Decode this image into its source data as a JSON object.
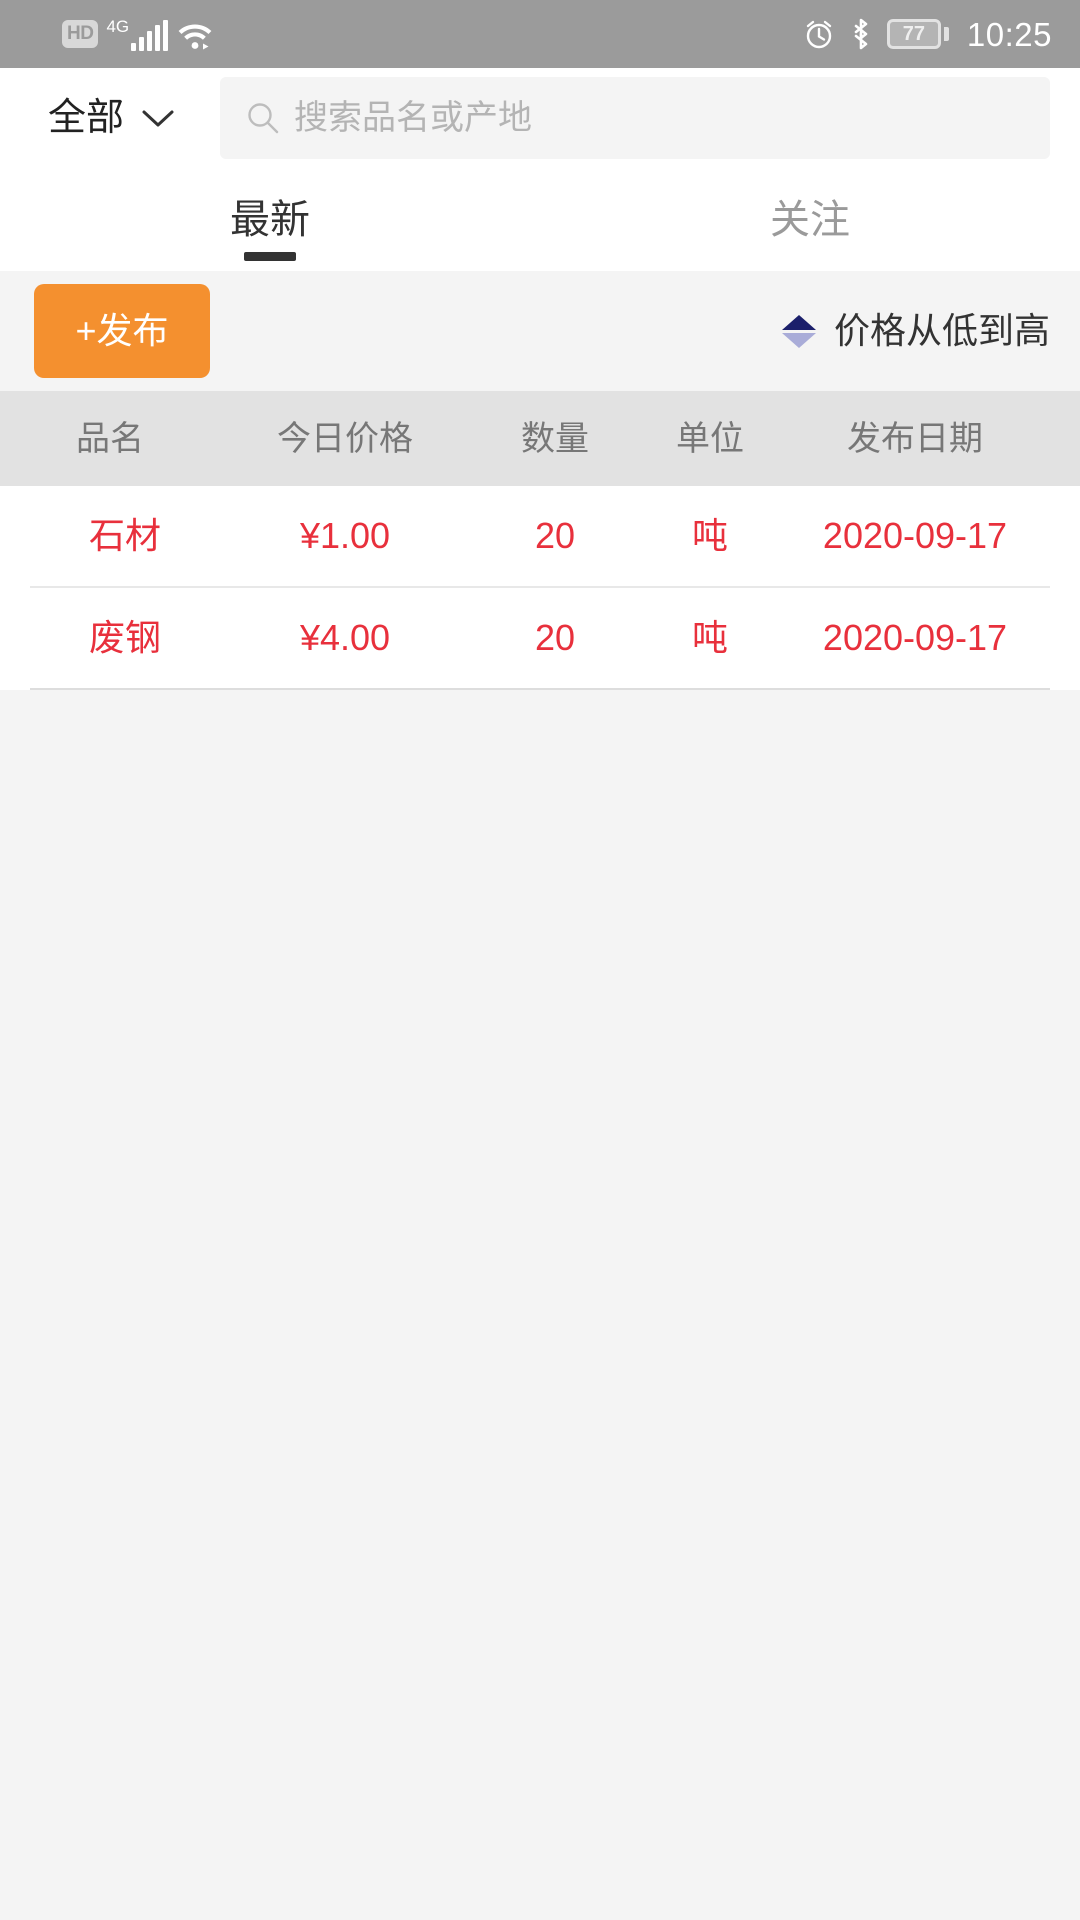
{
  "status_bar": {
    "hd_label": "HD",
    "network_label": "4G",
    "signal_icon": "signal-bars-icon",
    "wifi_icon": "wifi-icon",
    "alarm_icon": "alarm-clock-icon",
    "bluetooth_icon": "bluetooth-icon",
    "battery_level": "77",
    "time": "10:25",
    "background_color": "#9b9b9b"
  },
  "search_header": {
    "category_label": "全部",
    "category_chevron_icon": "chevron-down-icon",
    "search_icon": "search-icon",
    "search_placeholder": "搜索品名或产地",
    "search_value": ""
  },
  "tabs": [
    {
      "label": "最新",
      "active": true
    },
    {
      "label": "关注",
      "active": false
    }
  ],
  "action_bar": {
    "publish_label": "+发布",
    "publish_color": "#f4902f",
    "sort_label": "价格从低到高",
    "sort_icon": "sort-ascending-icon",
    "sort_up_color": "#1b1f6b",
    "sort_down_color": "#a9acd8"
  },
  "table": {
    "headers": [
      "品名",
      "今日价格",
      "数量",
      "单位",
      "发布日期"
    ],
    "row_text_color": "#e8303c",
    "rows": [
      {
        "name": "石材",
        "price": "¥1.00",
        "quantity": "20",
        "unit": "吨",
        "date": "2020-09-17"
      },
      {
        "name": "废钢",
        "price": "¥4.00",
        "quantity": "20",
        "unit": "吨",
        "date": "2020-09-17"
      }
    ]
  }
}
